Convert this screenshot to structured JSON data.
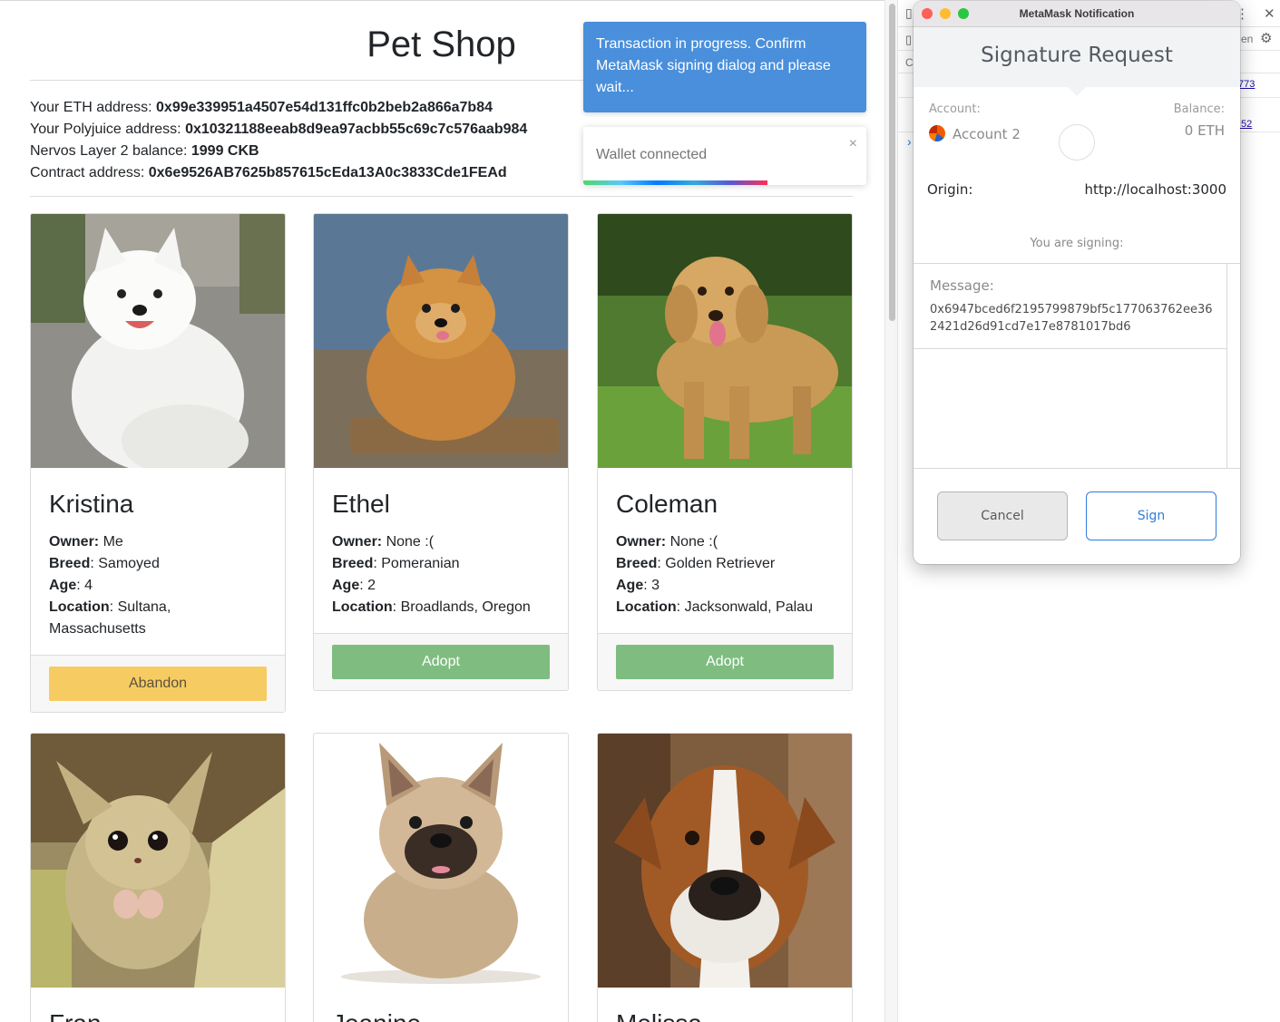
{
  "shop": {
    "title": "Pet Shop",
    "info": [
      {
        "label": "Your ETH address: ",
        "value": "0x99e339951a4507e54d131ffc0b2beb2a866a7b84"
      },
      {
        "label": "Your Polyjuice address: ",
        "value": "0x10321188eeab8d9ea97acbb55c69c7c576aab984"
      },
      {
        "label": "Nervos Layer 2 balance: ",
        "value": "1999 CKB"
      },
      {
        "label": "Contract address: ",
        "value": "0x6e9526AB7625b857615cEda13A0c3833Cde1FEAd"
      }
    ],
    "labels": {
      "owner": "Owner:",
      "breed": "Breed",
      "age": "Age",
      "location": "Location"
    },
    "pets": [
      {
        "name": "Kristina",
        "owner": "Me",
        "breed": "Samoyed",
        "age": "4",
        "location": "Sultana, Massachusetts",
        "action": "Abandon"
      },
      {
        "name": "Ethel",
        "owner": "None :(",
        "breed": "Pomeranian",
        "age": "2",
        "location": "Broadlands, Oregon",
        "action": "Adopt"
      },
      {
        "name": "Coleman",
        "owner": "None :(",
        "breed": "Golden Retriever",
        "age": "3",
        "location": "Jacksonwald, Palau",
        "action": "Adopt"
      },
      {
        "name": "Fran"
      },
      {
        "name": "Jeanine"
      },
      {
        "name": "Melissa"
      }
    ]
  },
  "toasts": {
    "progress_message": "Transaction in progress. Confirm MetaMask signing dialog and please wait...",
    "wallet_message": "Wallet connected",
    "wallet_close": "×",
    "wallet_progress": 0.65
  },
  "devtools": {
    "link1": "773",
    "link2": ":52",
    "partial_text": "en",
    "partial_c": "C",
    "chevron": "›",
    "close": "✕",
    "more": "⋮",
    "gear": "⚙"
  },
  "metamask": {
    "window_title": "MetaMask Notification",
    "heading": "Signature Request",
    "account_label": "Account:",
    "account_name": "Account 2",
    "balance_label": "Balance:",
    "balance_value": "0 ETH",
    "origin_label": "Origin:",
    "origin_value": "http://localhost:3000",
    "signing_label": "You are signing:",
    "message_label": "Message:",
    "message_value": "0x6947bced6f2195799879bf5c177063762ee362421d26d91cd7e17e8781017bd6",
    "cancel_label": "Cancel",
    "sign_label": "Sign",
    "colors": {
      "close": "#fe5f57",
      "minimize": "#febc2e",
      "zoom": "#28c840",
      "accent": "#2f7cdb"
    }
  }
}
